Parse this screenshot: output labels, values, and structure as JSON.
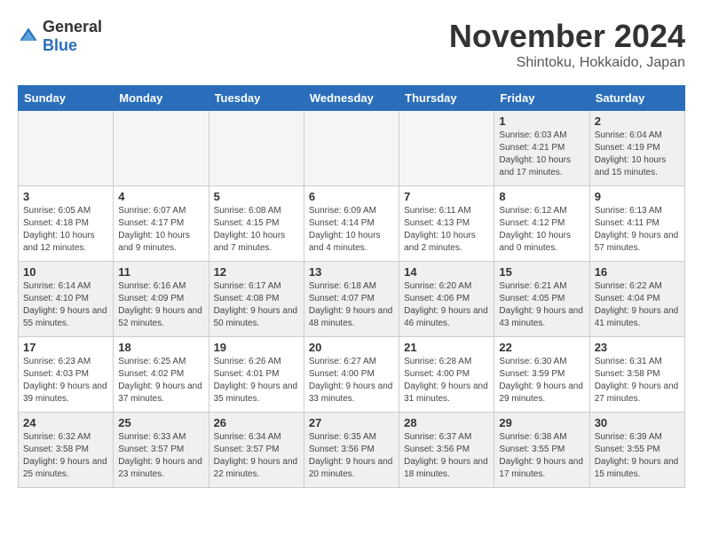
{
  "header": {
    "logo_general": "General",
    "logo_blue": "Blue",
    "month": "November 2024",
    "location": "Shintoku, Hokkaido, Japan"
  },
  "days_of_week": [
    "Sunday",
    "Monday",
    "Tuesday",
    "Wednesday",
    "Thursday",
    "Friday",
    "Saturday"
  ],
  "weeks": [
    [
      {
        "day": "",
        "info": ""
      },
      {
        "day": "",
        "info": ""
      },
      {
        "day": "",
        "info": ""
      },
      {
        "day": "",
        "info": ""
      },
      {
        "day": "",
        "info": ""
      },
      {
        "day": "1",
        "info": "Sunrise: 6:03 AM\nSunset: 4:21 PM\nDaylight: 10 hours and 17 minutes."
      },
      {
        "day": "2",
        "info": "Sunrise: 6:04 AM\nSunset: 4:19 PM\nDaylight: 10 hours and 15 minutes."
      }
    ],
    [
      {
        "day": "3",
        "info": "Sunrise: 6:05 AM\nSunset: 4:18 PM\nDaylight: 10 hours and 12 minutes."
      },
      {
        "day": "4",
        "info": "Sunrise: 6:07 AM\nSunset: 4:17 PM\nDaylight: 10 hours and 9 minutes."
      },
      {
        "day": "5",
        "info": "Sunrise: 6:08 AM\nSunset: 4:15 PM\nDaylight: 10 hours and 7 minutes."
      },
      {
        "day": "6",
        "info": "Sunrise: 6:09 AM\nSunset: 4:14 PM\nDaylight: 10 hours and 4 minutes."
      },
      {
        "day": "7",
        "info": "Sunrise: 6:11 AM\nSunset: 4:13 PM\nDaylight: 10 hours and 2 minutes."
      },
      {
        "day": "8",
        "info": "Sunrise: 6:12 AM\nSunset: 4:12 PM\nDaylight: 10 hours and 0 minutes."
      },
      {
        "day": "9",
        "info": "Sunrise: 6:13 AM\nSunset: 4:11 PM\nDaylight: 9 hours and 57 minutes."
      }
    ],
    [
      {
        "day": "10",
        "info": "Sunrise: 6:14 AM\nSunset: 4:10 PM\nDaylight: 9 hours and 55 minutes."
      },
      {
        "day": "11",
        "info": "Sunrise: 6:16 AM\nSunset: 4:09 PM\nDaylight: 9 hours and 52 minutes."
      },
      {
        "day": "12",
        "info": "Sunrise: 6:17 AM\nSunset: 4:08 PM\nDaylight: 9 hours and 50 minutes."
      },
      {
        "day": "13",
        "info": "Sunrise: 6:18 AM\nSunset: 4:07 PM\nDaylight: 9 hours and 48 minutes."
      },
      {
        "day": "14",
        "info": "Sunrise: 6:20 AM\nSunset: 4:06 PM\nDaylight: 9 hours and 46 minutes."
      },
      {
        "day": "15",
        "info": "Sunrise: 6:21 AM\nSunset: 4:05 PM\nDaylight: 9 hours and 43 minutes."
      },
      {
        "day": "16",
        "info": "Sunrise: 6:22 AM\nSunset: 4:04 PM\nDaylight: 9 hours and 41 minutes."
      }
    ],
    [
      {
        "day": "17",
        "info": "Sunrise: 6:23 AM\nSunset: 4:03 PM\nDaylight: 9 hours and 39 minutes."
      },
      {
        "day": "18",
        "info": "Sunrise: 6:25 AM\nSunset: 4:02 PM\nDaylight: 9 hours and 37 minutes."
      },
      {
        "day": "19",
        "info": "Sunrise: 6:26 AM\nSunset: 4:01 PM\nDaylight: 9 hours and 35 minutes."
      },
      {
        "day": "20",
        "info": "Sunrise: 6:27 AM\nSunset: 4:00 PM\nDaylight: 9 hours and 33 minutes."
      },
      {
        "day": "21",
        "info": "Sunrise: 6:28 AM\nSunset: 4:00 PM\nDaylight: 9 hours and 31 minutes."
      },
      {
        "day": "22",
        "info": "Sunrise: 6:30 AM\nSunset: 3:59 PM\nDaylight: 9 hours and 29 minutes."
      },
      {
        "day": "23",
        "info": "Sunrise: 6:31 AM\nSunset: 3:58 PM\nDaylight: 9 hours and 27 minutes."
      }
    ],
    [
      {
        "day": "24",
        "info": "Sunrise: 6:32 AM\nSunset: 3:58 PM\nDaylight: 9 hours and 25 minutes."
      },
      {
        "day": "25",
        "info": "Sunrise: 6:33 AM\nSunset: 3:57 PM\nDaylight: 9 hours and 23 minutes."
      },
      {
        "day": "26",
        "info": "Sunrise: 6:34 AM\nSunset: 3:57 PM\nDaylight: 9 hours and 22 minutes."
      },
      {
        "day": "27",
        "info": "Sunrise: 6:35 AM\nSunset: 3:56 PM\nDaylight: 9 hours and 20 minutes."
      },
      {
        "day": "28",
        "info": "Sunrise: 6:37 AM\nSunset: 3:56 PM\nDaylight: 9 hours and 18 minutes."
      },
      {
        "day": "29",
        "info": "Sunrise: 6:38 AM\nSunset: 3:55 PM\nDaylight: 9 hours and 17 minutes."
      },
      {
        "day": "30",
        "info": "Sunrise: 6:39 AM\nSunset: 3:55 PM\nDaylight: 9 hours and 15 minutes."
      }
    ]
  ]
}
